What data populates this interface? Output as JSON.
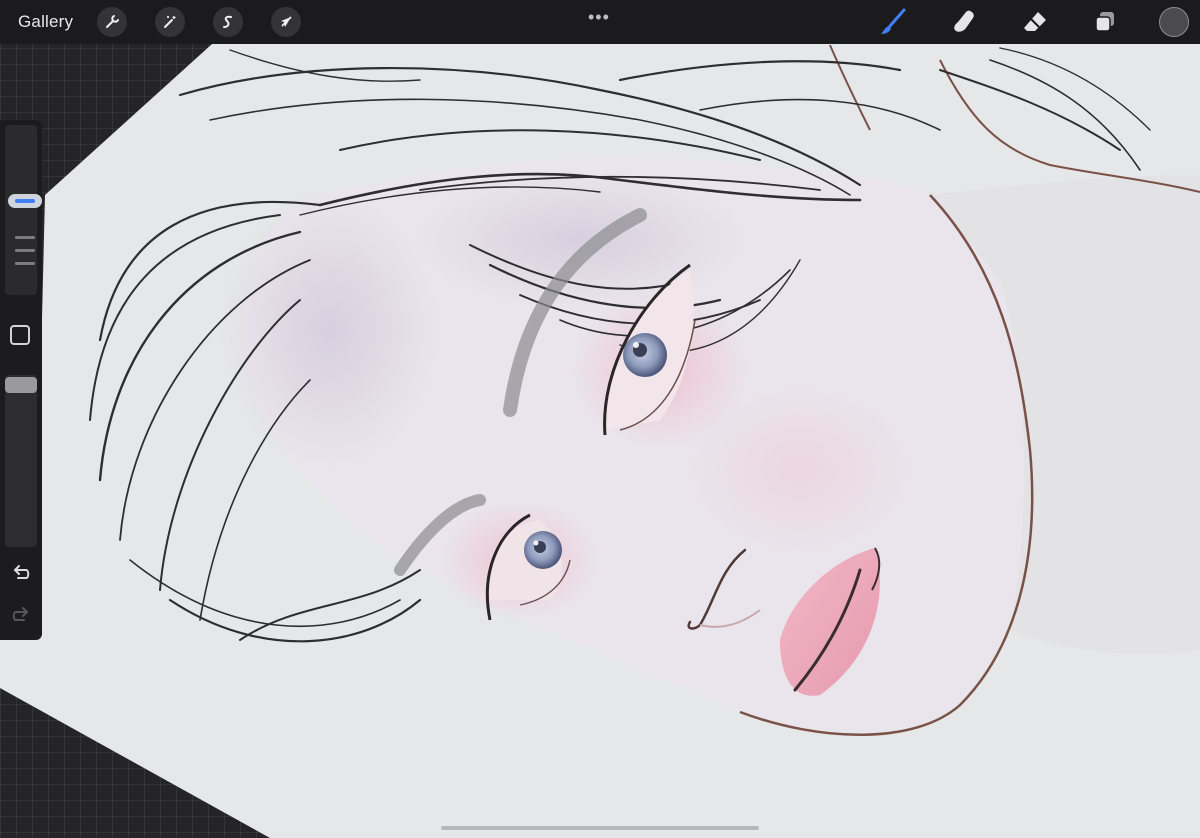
{
  "toolbar": {
    "gallery_label": "Gallery",
    "left_tools": [
      {
        "name": "actions",
        "icon": "wrench-icon"
      },
      {
        "name": "adjustments",
        "icon": "magic-wand-icon"
      },
      {
        "name": "selection",
        "icon": "selection-s-icon"
      },
      {
        "name": "transform",
        "icon": "arrow-cursor-icon"
      }
    ],
    "more_label": "•••",
    "right_tools": [
      {
        "name": "brush",
        "icon": "brush-icon",
        "active": true
      },
      {
        "name": "smudge",
        "icon": "smudge-finger-icon",
        "active": false
      },
      {
        "name": "eraser",
        "icon": "eraser-icon",
        "active": false
      },
      {
        "name": "layers",
        "icon": "layers-icon",
        "active": false
      }
    ],
    "current_color": "#4a4a4f"
  },
  "sidebar": {
    "brush_size_level": 0.56,
    "brush_opacity_level": 1.0,
    "modify_icon": "square-icon",
    "undo_icon": "undo-arrow-icon",
    "redo_icon": "redo-arrow-icon",
    "redo_enabled": false
  },
  "colors": {
    "accent": "#3f80f5",
    "toolbar_bg": "#1b1b1d",
    "canvas_paper": "#e6e7e9",
    "skin": "#e8e3ea",
    "blush": "#ecb6c5",
    "iris": "#8f9bbd"
  }
}
